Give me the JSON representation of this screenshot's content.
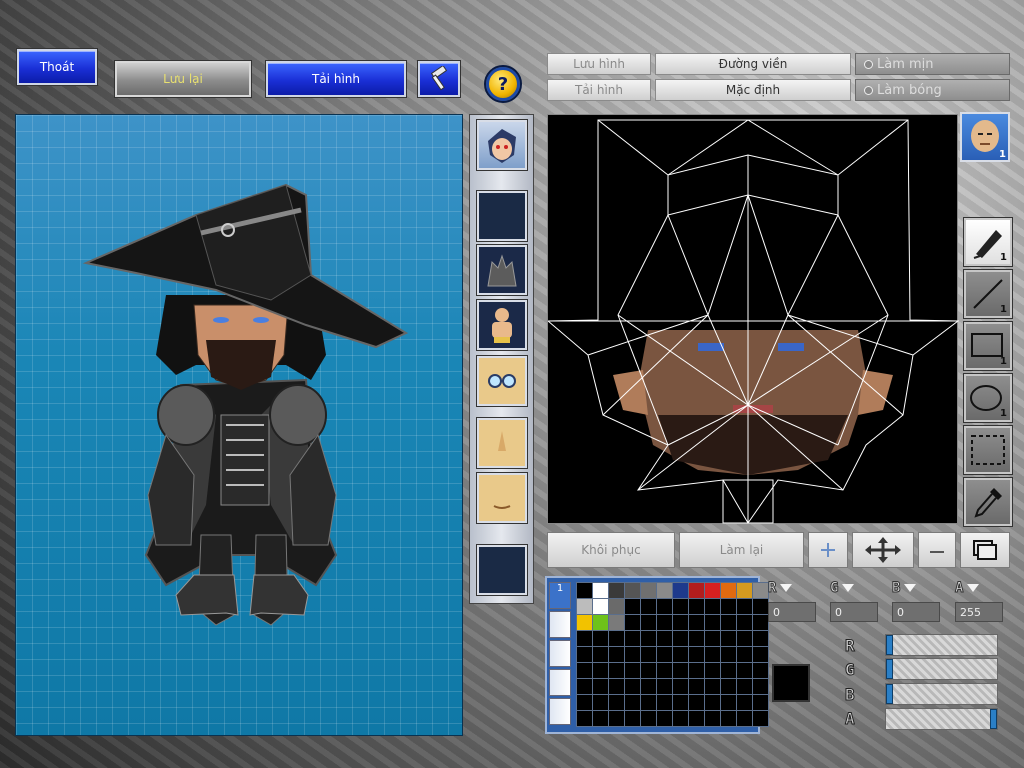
{
  "toolbar": {
    "exit_label": "Thoát",
    "save_label": "Lưu lại",
    "reload_label": "Tải hình",
    "help_label": "?"
  },
  "editor_tabs": {
    "save_image": "Lưu hình",
    "load_image": "Tải hình",
    "outline": "Đường viền",
    "default": "Mặc định",
    "smooth": "Làm mịn",
    "shade": "Làm bóng"
  },
  "parts": [
    {
      "name": "face-portrait"
    },
    {
      "name": "empty-slot"
    },
    {
      "name": "wolf-portrait"
    },
    {
      "name": "body-portrait"
    },
    {
      "name": "glasses-portrait"
    },
    {
      "name": "nose-portrait"
    },
    {
      "name": "mouth-portrait"
    },
    {
      "name": "empty-slot"
    }
  ],
  "tools": {
    "layer_count": "1",
    "pen_count": "1",
    "line_count": "1",
    "rect_count": "1",
    "ellipse_count": "1"
  },
  "actions": {
    "restore": "Khôi phục",
    "redo": "Làm lại"
  },
  "palette": {
    "tab_label": "1",
    "colors": [
      "#000000",
      "#ffffff",
      "#3a3a3a",
      "#555555",
      "#707070",
      "#8a8a8a",
      "#1e3a8c",
      "#b31d1d",
      "#d62020",
      "#e06a10",
      "#d49a20",
      "#8a8a8a",
      "#bcbcbc",
      "#ffffff",
      "#6a6a6a",
      "#000000",
      "#000000",
      "#000000",
      "#000000",
      "#000000",
      "#000000",
      "#000000",
      "#000000",
      "#000000",
      "#f2c200",
      "#6ec21a",
      "#7a7a7a"
    ]
  },
  "channels": {
    "r_label": "R",
    "g_label": "G",
    "b_label": "B",
    "a_label": "A",
    "r_value": "0",
    "g_value": "0",
    "b_value": "0",
    "a_value": "255",
    "r_level": 0,
    "g_level": 0,
    "b_level": 0,
    "a_level": 1
  },
  "current_color": "#000000"
}
